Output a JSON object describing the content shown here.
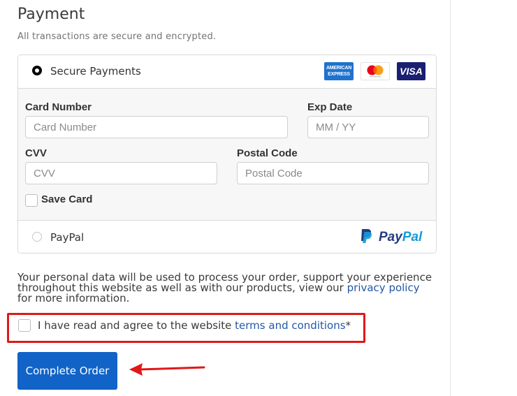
{
  "payment": {
    "title": "Payment",
    "subtitle": "All transactions are secure and encrypted."
  },
  "secure_option": {
    "label": "Secure Payments",
    "selected": true,
    "card_logos": [
      "amex-logo",
      "mastercard-logo",
      "visa-logo"
    ],
    "amex_top": "AMERICAN",
    "amex_bottom": "EXPRESS",
    "visa_text": "VISA"
  },
  "card_form": {
    "card_number_label": "Card Number",
    "card_number_placeholder": "Card Number",
    "card_number_value": "",
    "exp_date_label": "Exp Date",
    "exp_date_placeholder": "MM / YY",
    "exp_date_value": "",
    "cvv_label": "CVV",
    "cvv_placeholder": "CVV",
    "cvv_value": "",
    "postal_code_label": "Postal Code",
    "postal_code_placeholder": "Postal Code",
    "postal_code_value": "",
    "save_card_label": "Save Card",
    "save_card_checked": false
  },
  "paypal_option": {
    "label": "PayPal",
    "selected": false,
    "logo_text_pay": "Pay",
    "logo_text_pal": "Pal"
  },
  "privacy": {
    "text_before": "Your personal data will be used to process your order, support your experience throughout this website as well as with our products, view our ",
    "link_text": "privacy policy",
    "text_after": " for more information."
  },
  "terms": {
    "text_before": "I have read and agree to the website ",
    "link_text": "terms and conditions",
    "required_marker": "*",
    "checked": false
  },
  "complete_order": {
    "label": "Complete Order"
  },
  "colors": {
    "primary_button": "#1163c7",
    "link": "#2358a6",
    "highlight": "#e01818"
  }
}
